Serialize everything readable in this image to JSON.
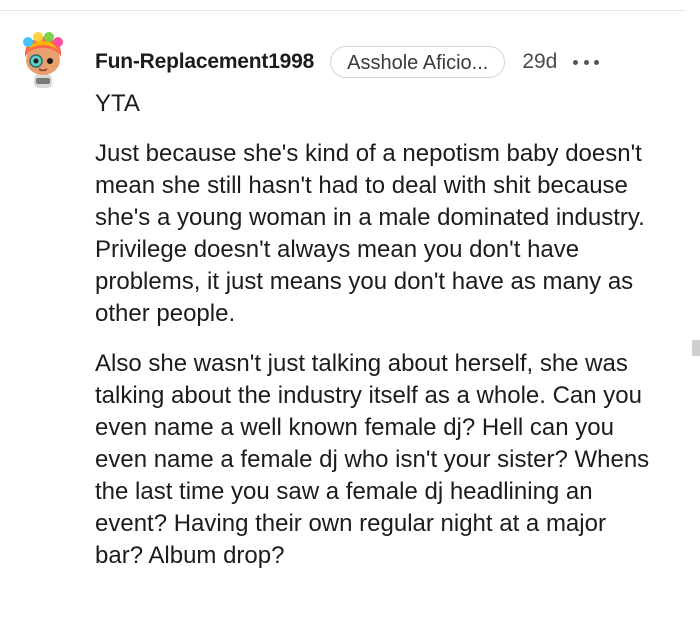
{
  "comment": {
    "username": "Fun-Replacement1998",
    "flair": "Asshole Aficio...",
    "timestamp": "29d",
    "paragraphs": [
      "YTA",
      "Just because she's kind of a nepotism baby doesn't mean she still hasn't had to deal with shit because she's a young woman in a male dominated industry. Privilege doesn't always mean you don't have problems, it just means you don't have as many as other people.",
      "Also she wasn't just talking about herself, she was talking about the industry itself as a whole. Can you even name a well known female dj? Hell can you even name a female dj who isn't your sister? Whens the last time you saw a female dj headlining an event? Having their own regular night at a major bar? Album drop?"
    ]
  },
  "icons": {
    "avatar": "snoo-avatar-icon",
    "more": "more-options-icon"
  },
  "colors": {
    "text": "#1c1c1c",
    "flair_border": "#d6d6d6",
    "muted": "#4a4a4a",
    "divider": "#e6e6e6"
  }
}
